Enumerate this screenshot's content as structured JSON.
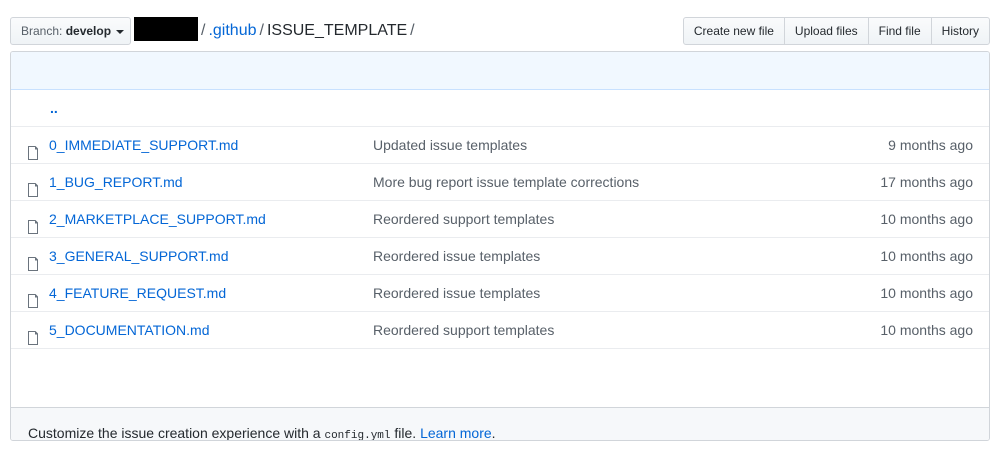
{
  "branch": {
    "prefix": "Branch:",
    "name": "develop"
  },
  "breadcrumb": {
    "sep1": "/",
    "dir": ".github",
    "sep2": "/",
    "current": "ISSUE_TEMPLATE",
    "sep3": "/"
  },
  "actions": {
    "create": "Create new file",
    "upload": "Upload files",
    "find": "Find file",
    "history": "History"
  },
  "parent_link": "..",
  "files": [
    {
      "name": "0_IMMEDIATE_SUPPORT.md",
      "message": "Updated issue templates",
      "age": "9 months ago"
    },
    {
      "name": "1_BUG_REPORT.md",
      "message": "More bug report issue template corrections",
      "age": "17 months ago"
    },
    {
      "name": "2_MARKETPLACE_SUPPORT.md",
      "message": "Reordered support templates",
      "age": "10 months ago"
    },
    {
      "name": "3_GENERAL_SUPPORT.md",
      "message": "Reordered issue templates",
      "age": "10 months ago"
    },
    {
      "name": "4_FEATURE_REQUEST.md",
      "message": "Reordered issue templates",
      "age": "10 months ago"
    },
    {
      "name": "5_DOCUMENTATION.md",
      "message": "Reordered support templates",
      "age": "10 months ago"
    }
  ],
  "footer": {
    "text_before": "Customize the issue creation experience with a ",
    "code": "config.yml",
    "text_after": " file. ",
    "link": "Learn more",
    "end": "."
  },
  "colors": {
    "link": "#0366d6",
    "tease_bg": "#f1f8ff",
    "muted": "#586069"
  }
}
